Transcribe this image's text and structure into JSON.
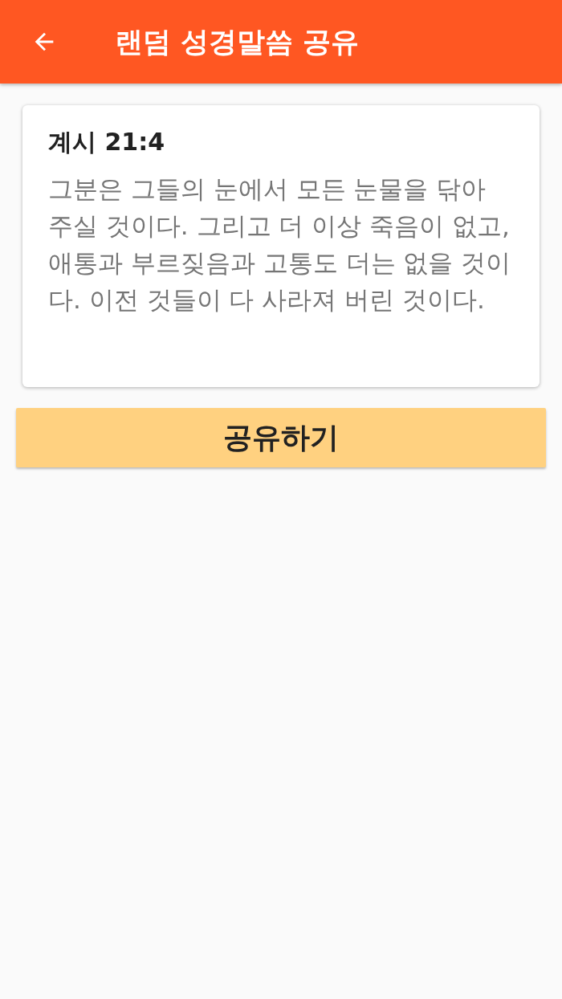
{
  "app_bar": {
    "title": "랜덤 성경말씀 공유"
  },
  "verse_card": {
    "reference": "계시 21:4",
    "text": "그분은 그들의 눈에서 모든 눈물을 닦아 주실 것이다. 그리고 더 이상 죽음이 없고, 애통과 부르짖음과 고통도 더는 없을 것이다. 이전 것들이 다 사라져 버린 것이다."
  },
  "buttons": [
    {
      "label": "공유하기"
    }
  ]
}
